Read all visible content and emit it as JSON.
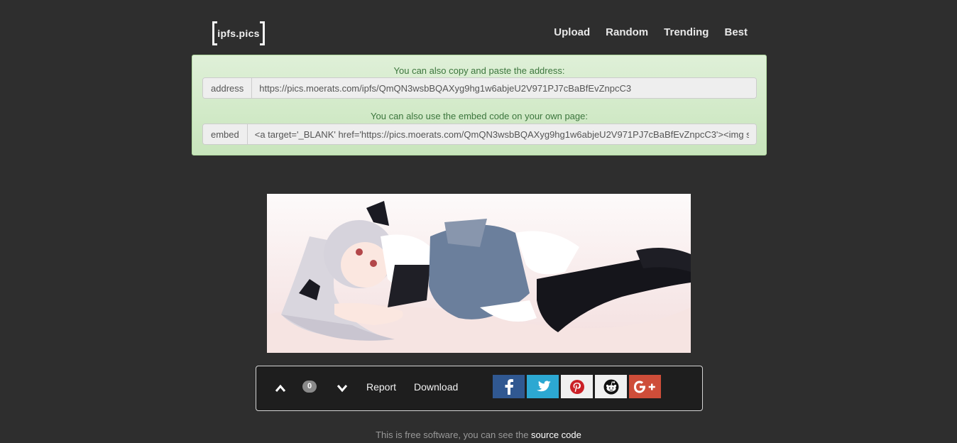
{
  "header": {
    "logo_text": "ipfs.pics",
    "nav": [
      "Upload",
      "Random",
      "Trending",
      "Best"
    ]
  },
  "share_panel": {
    "address_hint": "You can also copy and paste the address:",
    "address_label": "address",
    "address_value": "https://pics.moerats.com/ipfs/QmQN3wsbBQAXyg9hg1w6abjeU2V971PJ7cBaBfEvZnpcC3",
    "embed_hint": "You can also use the embed code on your own page:",
    "embed_label": "embed",
    "embed_value": "<a target='_BLANK' href='https://pics.moerats.com/QmQN3wsbBQAXyg9hg1w6abjeU2V971PJ7cBaBfEvZnpcC3'><img src="
  },
  "actions": {
    "score": "0",
    "report_label": "Report",
    "download_label": "Download",
    "share_icons": [
      "facebook-icon",
      "twitter-icon",
      "pinterest-icon",
      "reddit-icon",
      "google-plus-icon"
    ]
  },
  "footer": {
    "text": "This is free software, you can see the ",
    "link": "source code"
  },
  "colors": {
    "background": "#2e2e2e",
    "panel_bg": "#dff0d8",
    "panel_text": "#3c763d",
    "facebook": "#305891",
    "twitter": "#2ca8d2",
    "pinterest": "#cb2027",
    "googleplus": "#ce4d39"
  }
}
